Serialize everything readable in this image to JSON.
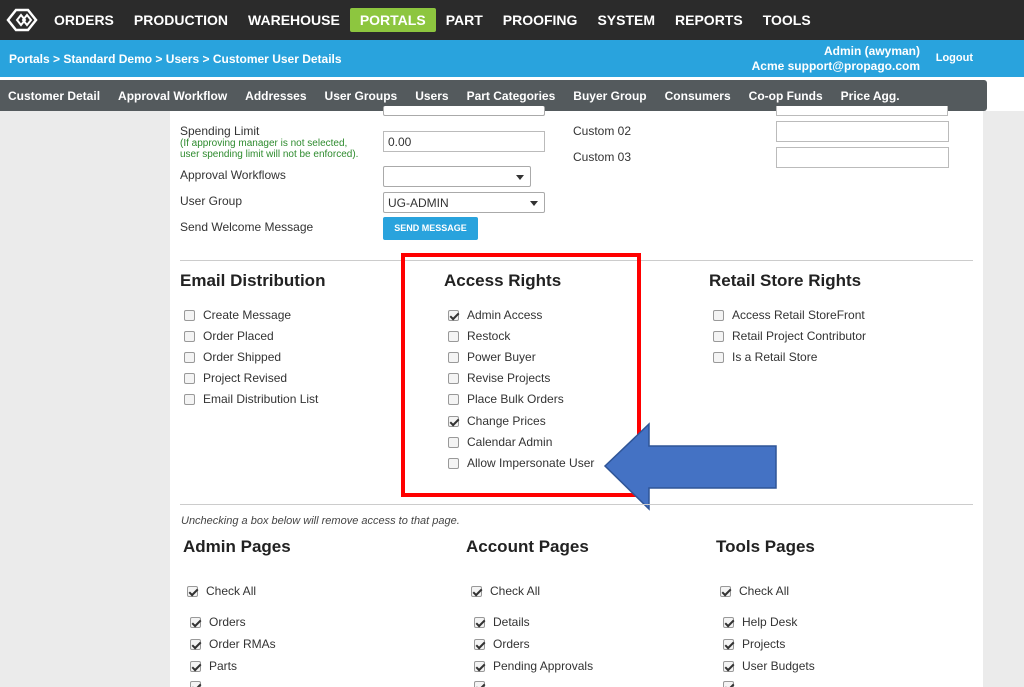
{
  "topnav": {
    "items": [
      "ORDERS",
      "PRODUCTION",
      "WAREHOUSE",
      "PORTALS",
      "PART",
      "PROOFING",
      "SYSTEM",
      "REPORTS",
      "TOOLS"
    ],
    "active": "PORTALS"
  },
  "breadcrumb": {
    "items": [
      "Portals",
      "Standard Demo",
      "Users",
      "Customer User Details"
    ],
    "separator": ">"
  },
  "user": {
    "name": "Admin (awyman)",
    "org": "Acme support@propago.com",
    "logout": "Logout"
  },
  "subnav": [
    "Customer Detail",
    "Approval Workflow",
    "Addresses",
    "User Groups",
    "Users",
    "Part Categories",
    "Buyer Group",
    "Consumers",
    "Co-op Funds",
    "Price Agg."
  ],
  "form": {
    "spending_limit_label": "Spending Limit",
    "spending_note_1": "(If approving manager is not selected,",
    "spending_note_2": "user spending limit will not be enforced).",
    "spending_value": "0.00",
    "approval_workflows_label": "Approval Workflows",
    "approval_workflows_value": "",
    "user_group_label": "User Group",
    "user_group_value": "UG-ADMIN",
    "send_welcome_label": "Send Welcome Message",
    "send_message_button": "SEND MESSAGE",
    "custom02_label": "Custom 02",
    "custom03_label": "Custom 03"
  },
  "email_distribution": {
    "title": "Email Distribution",
    "items": [
      {
        "label": "Create Message",
        "checked": false
      },
      {
        "label": "Order Placed",
        "checked": false
      },
      {
        "label": "Order Shipped",
        "checked": false
      },
      {
        "label": "Project Revised",
        "checked": false
      },
      {
        "label": "Email Distribution List",
        "checked": false
      }
    ]
  },
  "access_rights": {
    "title": "Access Rights",
    "items": [
      {
        "label": "Admin Access",
        "checked": true
      },
      {
        "label": "Restock",
        "checked": false
      },
      {
        "label": "Power Buyer",
        "checked": false
      },
      {
        "label": "Revise Projects",
        "checked": false
      },
      {
        "label": "Place Bulk Orders",
        "checked": false
      },
      {
        "label": "Change Prices",
        "checked": true
      },
      {
        "label": "Calendar Admin",
        "checked": false
      },
      {
        "label": "Allow Impersonate User",
        "checked": false
      }
    ]
  },
  "retail_store_rights": {
    "title": "Retail Store Rights",
    "items": [
      {
        "label": "Access Retail StoreFront",
        "checked": false
      },
      {
        "label": "Retail Project Contributor",
        "checked": false
      },
      {
        "label": "Is a Retail Store",
        "checked": false
      }
    ]
  },
  "pages_note": "Unchecking a box below will remove access to that page.",
  "admin_pages": {
    "title": "Admin Pages",
    "check_all": "Check All",
    "items": [
      "Orders",
      "Order RMAs",
      "Parts"
    ]
  },
  "account_pages": {
    "title": "Account Pages",
    "check_all": "Check All",
    "items": [
      "Details",
      "Orders",
      "Pending Approvals"
    ]
  },
  "tools_pages": {
    "title": "Tools Pages",
    "check_all": "Check All",
    "items": [
      "Help Desk",
      "Projects",
      "User Budgets"
    ]
  },
  "colors": {
    "topnav_bg": "#2b2b2b",
    "active_tab": "#8dc63f",
    "breadcrumb_bg": "#29a3dd",
    "subnav_bg": "#545a5d",
    "highlight_box": "#ff0000",
    "arrow": "#4472c4"
  },
  "icons": {
    "logo": "propago-logo-icon",
    "arrow": "left-arrow-annotation-icon"
  }
}
